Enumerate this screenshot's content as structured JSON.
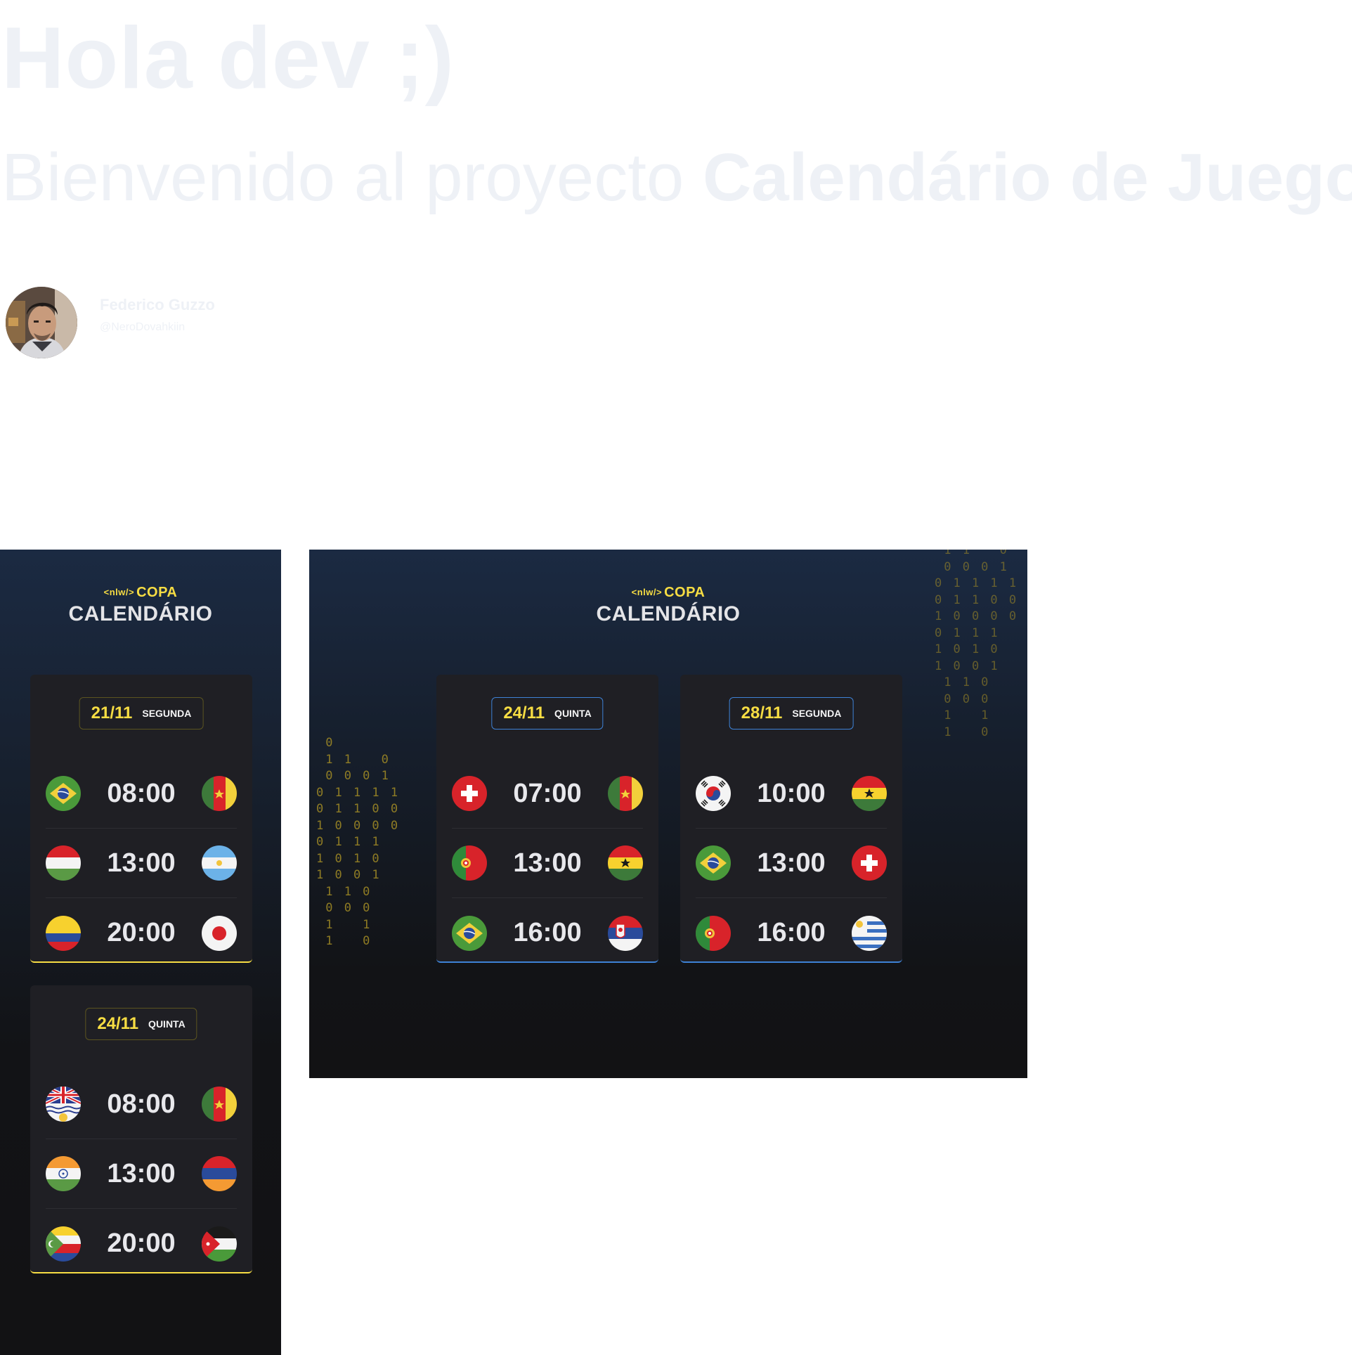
{
  "hero": {
    "title": "Hola dev ;)",
    "subtitle_prefix": "Bienvenido al proyecto ",
    "subtitle_bold": "Calendário de Juegos"
  },
  "author": {
    "name": "Federico Guzzo",
    "handle": "@NeroDovahkiin"
  },
  "app": {
    "logo_small": "<nlw/>",
    "logo_big": "COPA",
    "title": "CALENDÁRIO"
  },
  "left_preview": {
    "cards": [
      {
        "date": "21/11",
        "day": "SEGUNDA",
        "games": [
          {
            "home": "brazil-flag",
            "time": "08:00",
            "away": "cameroon-flag"
          },
          {
            "home": "hungary-flag",
            "time": "13:00",
            "away": "argentina-flag"
          },
          {
            "home": "colombia-flag",
            "time": "20:00",
            "away": "japan-flag"
          }
        ]
      },
      {
        "date": "24/11",
        "day": "QUINTA",
        "games": [
          {
            "home": "british-territory-flag",
            "time": "08:00",
            "away": "cameroon-flag"
          },
          {
            "home": "india-flag",
            "time": "13:00",
            "away": "armenia-flag"
          },
          {
            "home": "comoros-flag",
            "time": "20:00",
            "away": "jordan-flag"
          }
        ]
      }
    ]
  },
  "right_preview": {
    "cards": [
      {
        "date": "24/11",
        "day": "QUINTA",
        "games": [
          {
            "home": "switzerland-flag",
            "time": "07:00",
            "away": "cameroon-flag"
          },
          {
            "home": "portugal-flag",
            "time": "13:00",
            "away": "ghana-flag"
          },
          {
            "home": "brazil-flag",
            "time": "16:00",
            "away": "serbia-flag"
          }
        ]
      },
      {
        "date": "28/11",
        "day": "SEGUNDA",
        "games": [
          {
            "home": "south-korea-flag",
            "time": "10:00",
            "away": "ghana-flag"
          },
          {
            "home": "brazil-flag",
            "time": "13:00",
            "away": "switzerland-flag"
          },
          {
            "home": "portugal-flag",
            "time": "16:00",
            "away": "uruguay-flag"
          }
        ]
      }
    ]
  },
  "decor": {
    "binary_left": " 0\n 1 1   0\n 0 0 0 1\n0 1 1 1 1\n0 1 1 0 0\n1 0 0 0 0\n0 1 1 1\n1 0 1 0\n1 0 0 1\n 1 1 0\n 0 0 0\n 1   1\n 1   0",
    "binary_right": " 1 1   0\n 0 0 0 1\n0 1 1 1 1\n0 1 1 0 0\n1 0 0 0 0\n0 1 1 1\n1 0 1 0\n1 0 0 1\n 1 1 0\n 0 0 0\n 1   1\n 1   0"
  },
  "colors": {
    "accent_yellow": "#f7dd43",
    "accent_blue": "#3e82d6",
    "card_bg": "#1f1f24",
    "hero_text": "#eef1f6"
  }
}
